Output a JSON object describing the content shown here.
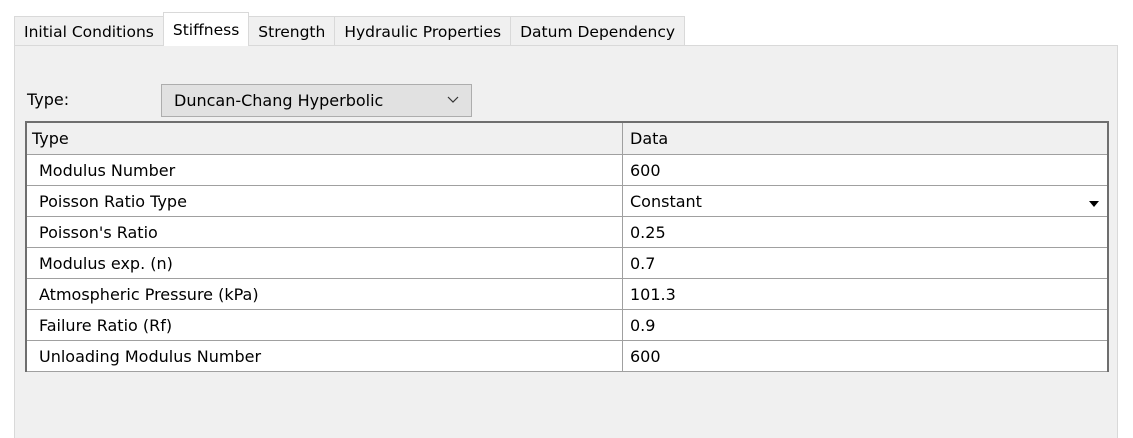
{
  "tabs": [
    {
      "label": "Initial Conditions",
      "active": false
    },
    {
      "label": "Stiffness",
      "active": true
    },
    {
      "label": "Strength",
      "active": false
    },
    {
      "label": "Hydraulic Properties",
      "active": false
    },
    {
      "label": "Datum Dependency",
      "active": false
    }
  ],
  "type_label": "Type:",
  "type_value": "Duncan-Chang Hyperbolic",
  "table": {
    "headers": [
      "Type",
      "Data"
    ],
    "rows": [
      {
        "name": "Modulus Number",
        "value": "600"
      },
      {
        "name": "Poisson Ratio Type",
        "value": "Constant"
      },
      {
        "name": "Poisson's Ratio",
        "value": "0.25"
      },
      {
        "name": "Modulus exp. (n)",
        "value": "0.7"
      },
      {
        "name": "Atmospheric Pressure (kPa)",
        "value": "101.3"
      },
      {
        "name": "Failure Ratio (Rf)",
        "value": "0.9"
      },
      {
        "name": "Unloading Modulus Number",
        "value": "600"
      }
    ]
  },
  "colors": {
    "panel_bg": "#f0f0f0",
    "grid_border": "#6e6e6e"
  },
  "icons": {
    "combo": "chevron-down-icon",
    "cell_dropdown": "dropdown-arrow-icon"
  }
}
